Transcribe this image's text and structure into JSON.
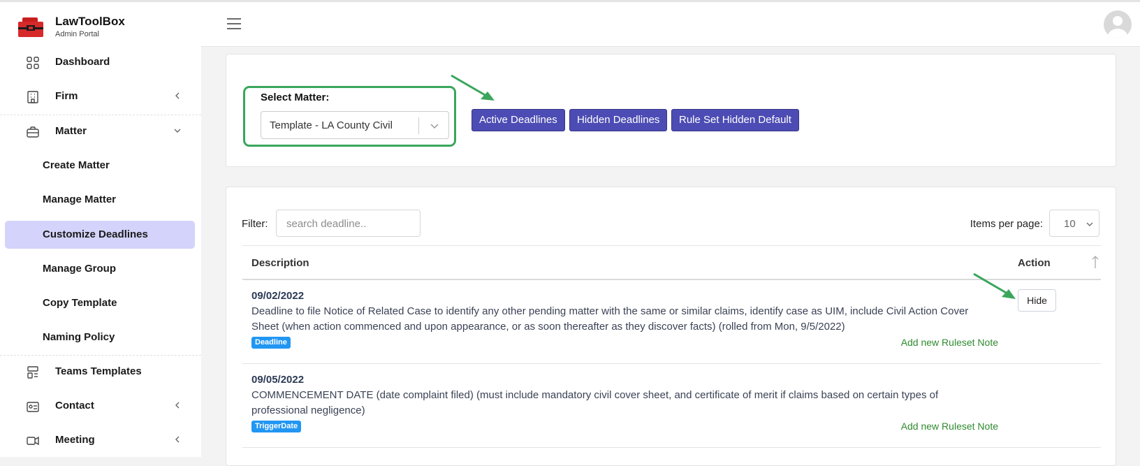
{
  "brand": {
    "name": "LawToolBox",
    "subtitle": "Admin Portal"
  },
  "sidebar": {
    "items": [
      {
        "label": "Dashboard",
        "icon": "grid-icon",
        "expandable": false
      },
      {
        "label": "Firm",
        "icon": "building-icon",
        "expandable": true,
        "chevron": "chevron-left"
      },
      {
        "label": "Matter",
        "icon": "briefcase-icon",
        "expandable": true,
        "chevron": "chevron-down"
      }
    ],
    "matter_subitems": [
      {
        "label": "Create Matter",
        "active": false
      },
      {
        "label": "Manage Matter",
        "active": false
      },
      {
        "label": "Customize Deadlines",
        "active": true
      },
      {
        "label": "Manage Group",
        "active": false
      },
      {
        "label": "Copy Template",
        "active": false
      },
      {
        "label": "Naming Policy",
        "active": false
      }
    ],
    "lower_items": [
      {
        "label": "Teams Templates",
        "icon": "template-icon",
        "expandable": false
      },
      {
        "label": "Contact",
        "icon": "contact-card-icon",
        "expandable": true,
        "chevron": "chevron-left"
      },
      {
        "label": "Meeting",
        "icon": "video-icon",
        "expandable": true,
        "chevron": "chevron-left"
      }
    ]
  },
  "matter_select": {
    "label": "Select Matter:",
    "value": "Template - LA County Civil"
  },
  "buttons": {
    "active": "Active Deadlines",
    "hidden": "Hidden Deadlines",
    "ruleset": "Rule Set Hidden Default"
  },
  "table": {
    "filter_label": "Filter:",
    "filter_placeholder": "search deadline..",
    "ipp_label": "Items per page:",
    "ipp_value": "10",
    "headers": {
      "description": "Description",
      "action": "Action"
    },
    "rows": [
      {
        "date": "09/02/2022",
        "description": "Deadline to file Notice of Related Case to identify any other pending matter with the same or similar claims, identify case as UIM, include Civil Action Cover Sheet (when action commenced and upon appearance, or as soon thereafter as they discover facts) (rolled from Mon, 9/5/2022)",
        "badge": "Deadline",
        "note_link": "Add new Ruleset Note",
        "action": "Hide"
      },
      {
        "date": "09/05/2022",
        "description": "COMMENCEMENT DATE (date complaint filed) (must include mandatory civil cover sheet, and certificate of merit if claims based on certain types of professional negligence)",
        "badge": "TriggerDate",
        "note_link": "Add new Ruleset Note"
      }
    ]
  },
  "colors": {
    "accent_purple": "#4c4cb4",
    "active_nav": "#d3d3fb",
    "highlight_green": "#3aa65c",
    "badge_blue": "#2196f3",
    "link_green": "#2e8b2e"
  }
}
